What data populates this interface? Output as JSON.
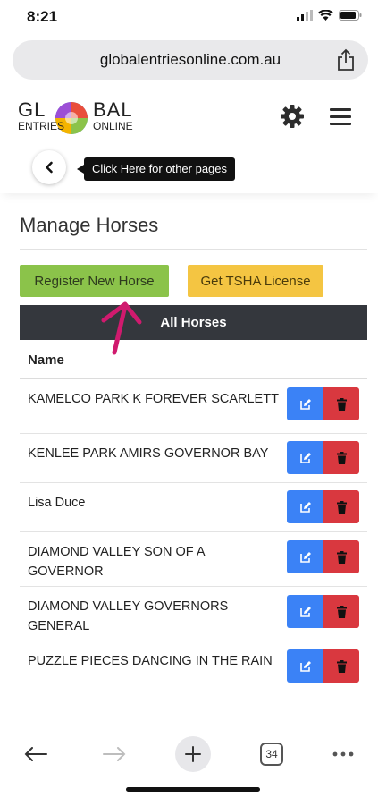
{
  "status": {
    "time": "8:21"
  },
  "browser": {
    "url": "globalentriesonline.com.au",
    "tab_count": "34"
  },
  "logo": {
    "top_left": "GL",
    "top_right": "BAL",
    "bottom_left": "ENTRIES",
    "bottom_right": "ONLINE"
  },
  "back": {
    "tooltip": "Click Here for other pages"
  },
  "page": {
    "title": "Manage Horses"
  },
  "actions": {
    "register": "Register New Horse",
    "license": "Get TSHA License"
  },
  "table": {
    "header": "All Horses",
    "column_name": "Name",
    "rows": [
      {
        "name": "KAMELCO PARK K FOREVER SCARLETT"
      },
      {
        "name": "KENLEE PARK AMIRS GOVERNOR BAY"
      },
      {
        "name": "Lisa Duce"
      },
      {
        "name": "DIAMOND VALLEY SON OF A GOVERNOR"
      },
      {
        "name": "DIAMOND VALLEY GOVERNORS GENERAL"
      },
      {
        "name": "PUZZLE PIECES DANCING IN THE RAIN"
      }
    ]
  },
  "colors": {
    "register_btn": "#8bc34a",
    "license_btn": "#f4c542",
    "edit_btn": "#3b82f6",
    "delete_btn": "#d9383f",
    "annotation_arrow": "#d01a6e"
  },
  "icons": [
    "signal-icon",
    "wifi-icon",
    "battery-icon",
    "share-icon",
    "globe-logo-icon",
    "gear-icon",
    "hamburger-menu-icon",
    "chevron-left-icon",
    "annotation-arrow-icon",
    "edit-icon",
    "trash-icon",
    "back-arrow-icon",
    "forward-arrow-icon",
    "plus-icon",
    "more-icon"
  ]
}
